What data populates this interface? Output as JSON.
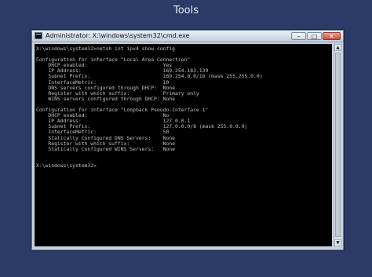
{
  "page": {
    "title": "Tools"
  },
  "window": {
    "title": "Administrator: X:\\windows\\system32\\cmd.exe",
    "controls": {
      "minimize": "–",
      "maximize": "□",
      "close": "✕"
    }
  },
  "console": {
    "lines": [
      "X:\\windows\\system32>netsh int ipv4 show config",
      "",
      "Configuration for interface \"Local Area Connection\"",
      "    DHCP enabled:                         Yes",
      "    IP Address:                           169.254.183.139",
      "    Subnet Prefix:                        169.254.0.0/16 (mask 255.255.0.0)",
      "    InterfaceMetric:                      10",
      "    DNS servers configured through DHCP:  None",
      "    Register with which suffix:           Primary only",
      "    WINS servers configured through DHCP: None",
      "",
      "Configuration for interface \"Loopback Pseudo-Interface 1\"",
      "    DHCP enabled:                         No",
      "    IP Address:                           127.0.0.1",
      "    Subnet Prefix:                        127.0.0.0/8 (mask 255.0.0.0)",
      "    InterfaceMetric:                      50",
      "    Statically Configured DNS Servers:    None",
      "    Register with which suffix:           None",
      "    Statically Configured WINS Servers:   None",
      "",
      "",
      "X:\\windows\\system32>"
    ]
  },
  "scrollbar": {
    "up_arrow": "▲",
    "down_arrow": "▼"
  }
}
